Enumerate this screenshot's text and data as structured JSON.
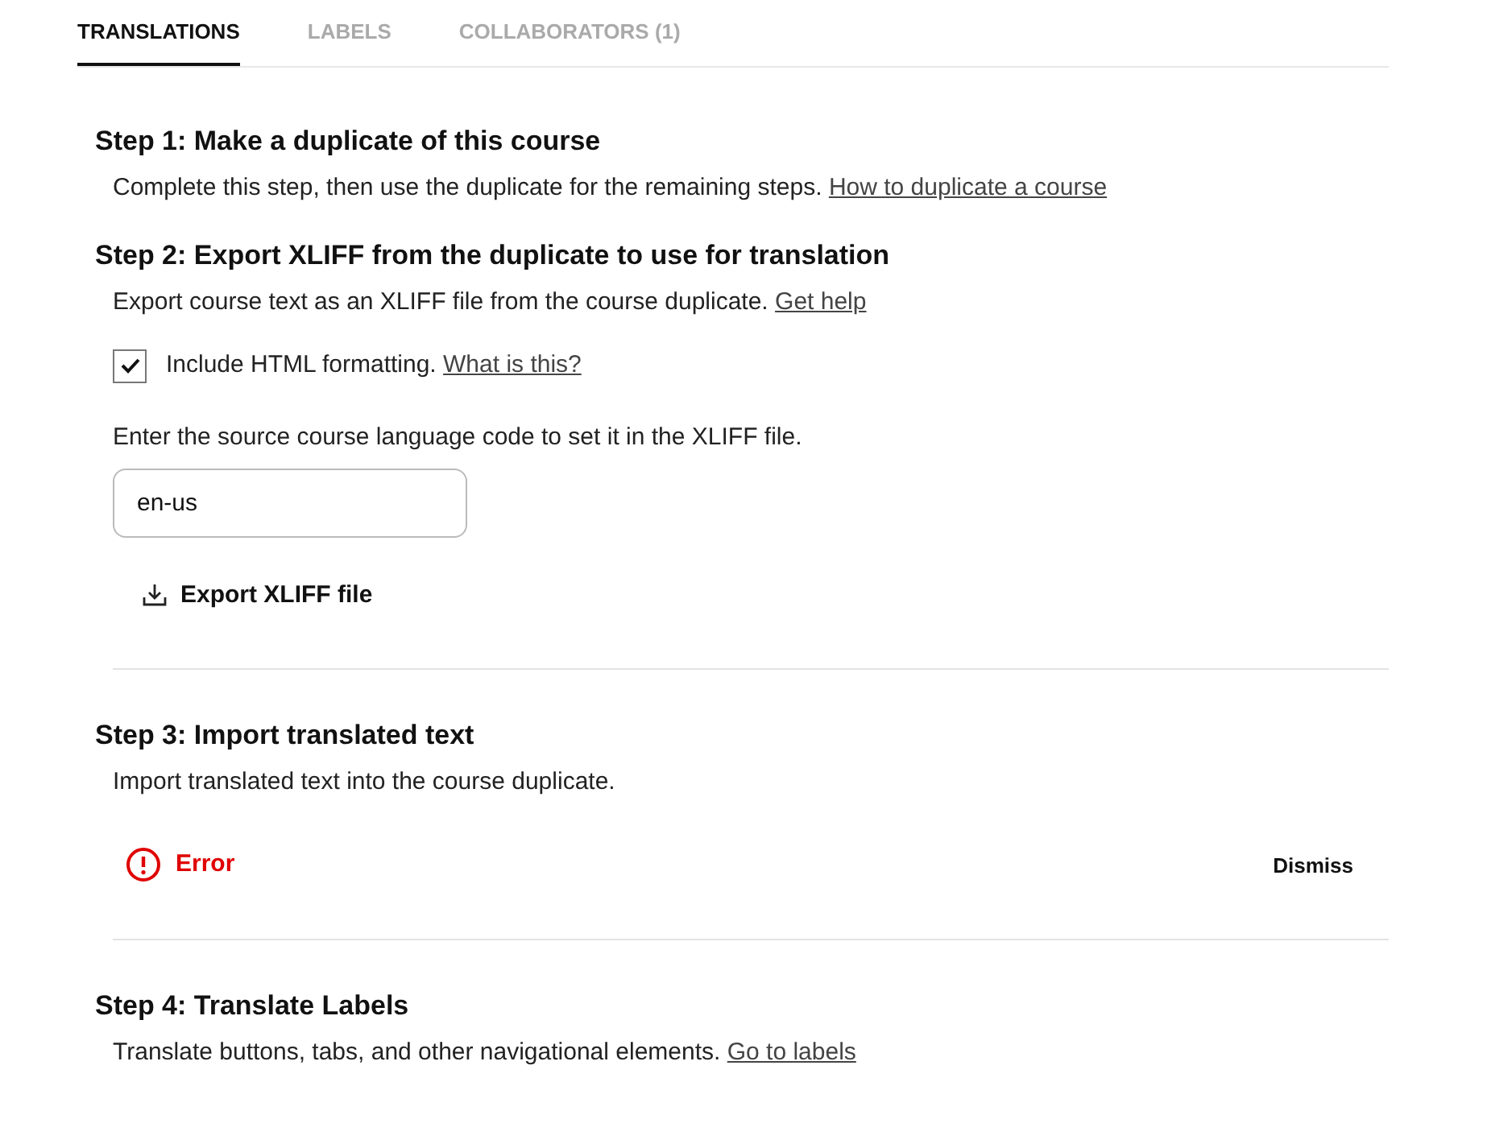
{
  "tabs": [
    {
      "label": "TRANSLATIONS",
      "selected": true
    },
    {
      "label": "LABELS",
      "selected": false
    },
    {
      "label": "COLLABORATORS (1)",
      "selected": false
    }
  ],
  "steps": [
    {
      "title": "Step 1: Make a duplicate of this course",
      "description": "Complete this step, then use the duplicate for the remaining steps.",
      "link": "How to duplicate a course",
      "divider_after": false
    },
    {
      "title": "Step 2: Export XLIFF from the duplicate to use for translation",
      "description": "Export course text as an XLIFF file from the course duplicate.",
      "link": "Get help",
      "checkbox": {
        "label": "Include HTML formatting.",
        "link": "What is this?",
        "checked": true
      },
      "field": {
        "label": "Enter the source course language code to set it in the XLIFF file.",
        "value": "en-us"
      },
      "button": "Export XLIFF file",
      "divider_after": true
    },
    {
      "title": "Step 3: Import translated text",
      "description": "Import translated text into the course duplicate.",
      "error": {
        "message": "Error",
        "action": "Dismiss"
      },
      "divider_after": true
    },
    {
      "title": "Step 4: Translate Labels",
      "description": "Translate buttons, tabs, and other navigational elements.",
      "link": "Go to labels",
      "divider_after": false
    }
  ]
}
